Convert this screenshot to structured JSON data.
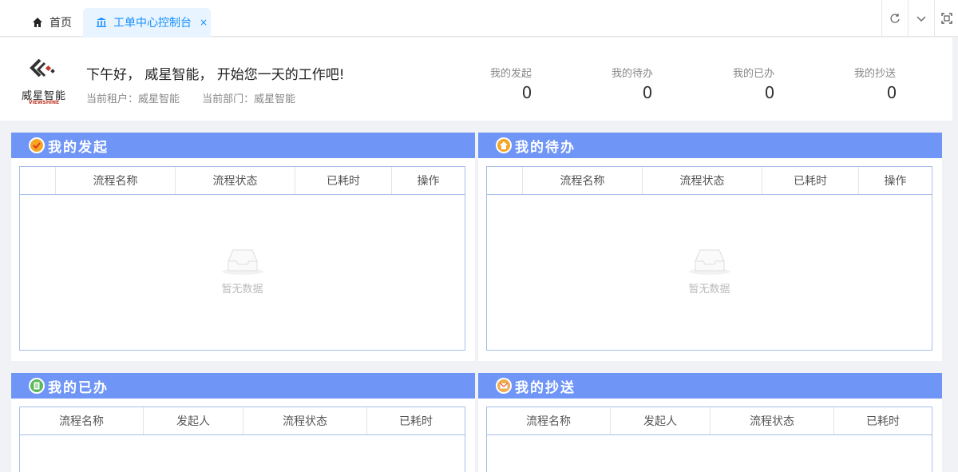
{
  "tabs": {
    "home_label": "首页",
    "active_label": "工单中心控制台",
    "close_glyph": "×"
  },
  "toolbar": {
    "refresh_icon": "refresh-icon",
    "dropdown_icon": "chevron-down-icon",
    "fullscreen_icon": "fullscreen-icon"
  },
  "header": {
    "logo_text": "威星智能",
    "logo_sub": "VIEWSHINE",
    "greeting": "下午好， 威星智能， 开始您一天的工作吧!",
    "tenant": "当前租户：威星智能",
    "department": "当前部门：威星智能",
    "stats": [
      {
        "label": "我的发起",
        "value": "0"
      },
      {
        "label": "我的待办",
        "value": "0"
      },
      {
        "label": "我的已办",
        "value": "0"
      },
      {
        "label": "我的抄送",
        "value": "0"
      }
    ]
  },
  "cards": {
    "started": {
      "title": "我的发起",
      "columns": [
        "",
        "流程名称",
        "流程状态",
        "已耗时",
        "操作"
      ],
      "empty": "暂无数据"
    },
    "todo": {
      "title": "我的待办",
      "columns": [
        "",
        "流程名称",
        "流程状态",
        "已耗时",
        "操作"
      ],
      "empty": "暂无数据"
    },
    "done": {
      "title": "我的已办",
      "columns": [
        "流程名称",
        "发起人",
        "流程状态",
        "已耗时"
      ]
    },
    "cc": {
      "title": "我的抄送",
      "columns": [
        "流程名称",
        "发起人",
        "流程状态",
        "已耗时"
      ]
    }
  },
  "colors": {
    "accent": "#1890ff",
    "card_header": "#6f95f6",
    "table_border": "#a9bfe8"
  }
}
